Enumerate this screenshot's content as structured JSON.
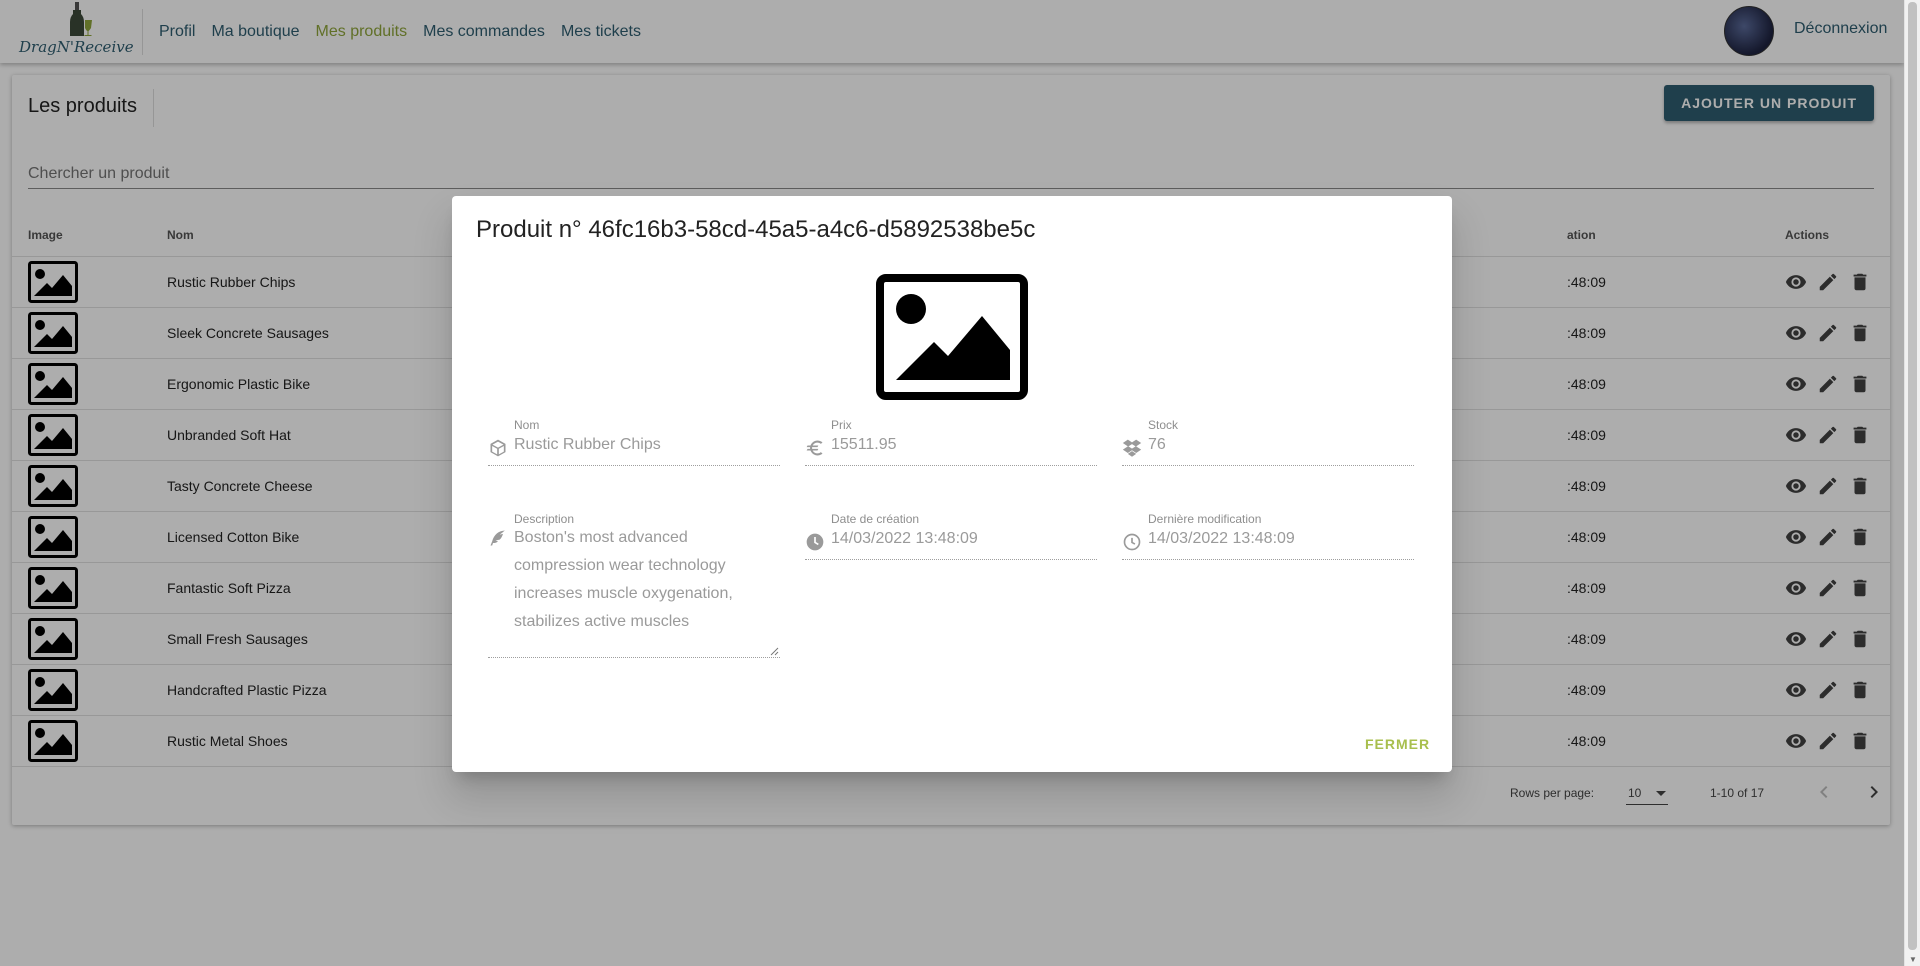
{
  "nav": {
    "logo_text": "DragN'Receive",
    "items": [
      {
        "label": "Profil",
        "active": false
      },
      {
        "label": "Ma boutique",
        "active": false
      },
      {
        "label": "Mes produits",
        "active": true
      },
      {
        "label": "Mes commandes",
        "active": false
      },
      {
        "label": "Mes tickets",
        "active": false
      }
    ],
    "logout_label": "Déconnexion"
  },
  "page": {
    "title": "Les produits",
    "add_button_label": "AJOUTER UN PRODUIT",
    "search_placeholder": "Chercher un produit"
  },
  "table": {
    "columns": [
      "Image",
      "Nom",
      "ation",
      "Actions"
    ],
    "rows": [
      {
        "name": "Rustic Rubber Chips",
        "date_fragment": ":48:09"
      },
      {
        "name": "Sleek Concrete Sausages",
        "date_fragment": ":48:09"
      },
      {
        "name": "Ergonomic Plastic Bike",
        "date_fragment": ":48:09"
      },
      {
        "name": "Unbranded Soft Hat",
        "date_fragment": ":48:09"
      },
      {
        "name": "Tasty Concrete Cheese",
        "date_fragment": ":48:09"
      },
      {
        "name": "Licensed Cotton Bike",
        "date_fragment": ":48:09"
      },
      {
        "name": "Fantastic Soft Pizza",
        "date_fragment": ":48:09"
      },
      {
        "name": "Small Fresh Sausages",
        "date_fragment": ":48:09"
      },
      {
        "name": "Handcrafted Plastic Pizza",
        "date_fragment": ":48:09"
      },
      {
        "name": "Rustic Metal Shoes",
        "date_fragment": ":48:09"
      }
    ]
  },
  "pagination": {
    "rows_per_page_label": "Rows per page:",
    "rows_per_page_value": "10",
    "range_label": "1-10 of 17"
  },
  "dialog": {
    "title": "Produit n° 46fc16b3-58cd-45a5-a4c6-d5892538be5c",
    "fields": {
      "nom": {
        "label": "Nom",
        "value": "Rustic Rubber Chips"
      },
      "prix": {
        "label": "Prix",
        "value": "15511.95"
      },
      "stock": {
        "label": "Stock",
        "value": "76"
      },
      "description": {
        "label": "Description",
        "value": "Boston's most advanced compression wear technology increases muscle oxygenation, stabilizes active muscles"
      },
      "date_creation": {
        "label": "Date de création",
        "value": "14/03/2022 13:48:09"
      },
      "derniere_modification": {
        "label": "Dernière modification",
        "value": "14/03/2022 13:48:09"
      }
    },
    "close_label": "FERMER"
  },
  "colors": {
    "primary": "#2f5e70",
    "accent": "#8fa63b",
    "close": "#a8bf4d"
  }
}
